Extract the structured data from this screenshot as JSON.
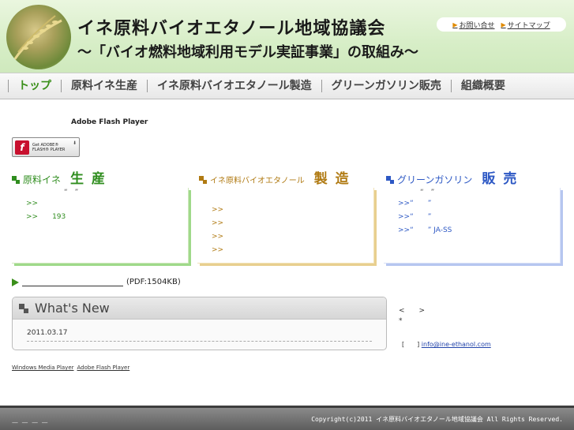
{
  "header": {
    "title": "イネ原料バイオエタノール地域協議会",
    "subtitle": "〜「バイオ燃料地域利用モデル実証事業」の取組み〜",
    "util_links": [
      "お問い合せ",
      "サイトマップ"
    ]
  },
  "nav": {
    "items": [
      {
        "label": "トップ"
      },
      {
        "label": "原料イネ生産"
      },
      {
        "label": "イネ原料バイオエタノール製造"
      },
      {
        "label": "グリーンガソリン販売"
      },
      {
        "label": "組織概要"
      }
    ]
  },
  "flash": {
    "note": "Adobe Flash Player",
    "badge_line1": "Get ADOBE®",
    "badge_line2": "FLASH® PLAYER"
  },
  "sections": {
    "production": {
      "prefix": "原料イネ",
      "title": "生 産",
      "quote": "“　”",
      "rows": [
        ">>",
        ">>　　193"
      ]
    },
    "manufacturing": {
      "prefix": "イネ原料バイオエタノール",
      "title": "製 造",
      "rows": [
        ">>",
        ">>",
        ">>",
        ">>"
      ]
    },
    "sales": {
      "prefix": "グリーンガソリン",
      "title": "販 売",
      "quote": "“　”",
      "rows": [
        ">>“　　”",
        ">>“　　”",
        ">>“　　” JA-SS"
      ]
    }
  },
  "pdf": {
    "label": "(PDF:1504KB)"
  },
  "whats_new": {
    "heading": "What's New",
    "date": "2011.03.17"
  },
  "side": {
    "line1": "<　　>",
    "line2": "*",
    "mail_prefix": "[　　]",
    "mail": "info@ine-ethanol.com"
  },
  "links": {
    "wmp": "Windows Media Player",
    "afp": "Adobe Flash Player"
  },
  "footer": {
    "copyright": "Copyright(c)2011 イネ原料バイオエタノール地域協議会 All Rights Reserved.",
    "dashes": "— — — —"
  },
  "colors": {
    "production": "#2f8d1e",
    "manufacturing": "#b07a12",
    "sales": "#2d58c4"
  }
}
